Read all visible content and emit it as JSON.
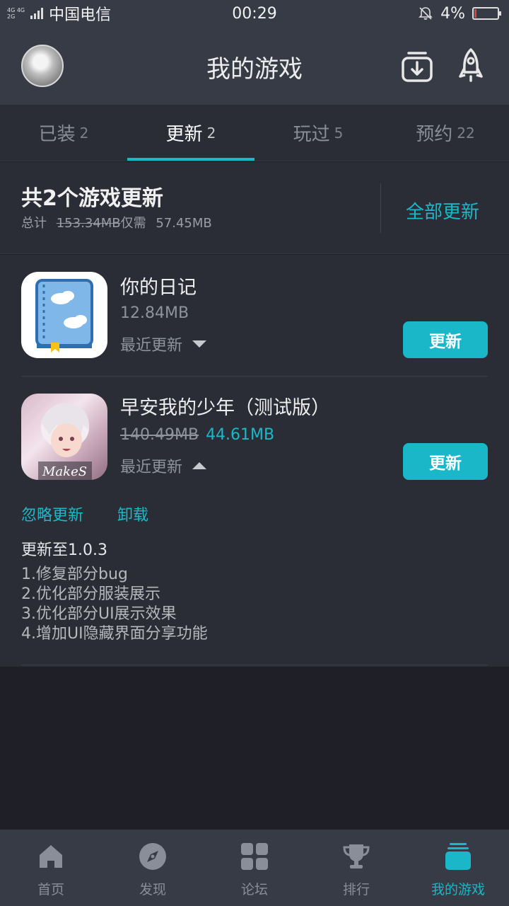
{
  "status_bar": {
    "network_top": "4G 4G",
    "network_bottom": "2G",
    "carrier": "中国电信",
    "time": "00:29",
    "battery": "4%"
  },
  "header": {
    "title": "我的游戏",
    "icons": [
      "avatar",
      "download-manager-icon",
      "rocket-icon"
    ]
  },
  "tabs": [
    {
      "label": "已装",
      "count": "2"
    },
    {
      "label": "更新",
      "count": "2",
      "active": true
    },
    {
      "label": "玩过",
      "count": "5"
    },
    {
      "label": "预约",
      "count": "22"
    }
  ],
  "summary": {
    "title": "共2个游戏更新",
    "total_label": "总计",
    "total_original": "153.34MB",
    "need_label": "仅需",
    "need_size": "57.45MB",
    "update_all": "全部更新"
  },
  "games": [
    {
      "name": "你的日记",
      "size": "12.84MB",
      "recent_label": "最近更新",
      "button": "更新",
      "expanded": false
    },
    {
      "name": "早安我的少年（测试版）",
      "old_size": "140.49MB",
      "new_size": "44.61MB",
      "recent_label": "最近更新",
      "button": "更新",
      "expanded": true,
      "icon_text": "MakeS",
      "ignore": "忽略更新",
      "uninstall": "卸载",
      "version": "更新至1.0.3",
      "notes": [
        "1.修复部分bug",
        "2.优化部分服装展示",
        "3.优化部分UI展示效果",
        "4.增加UI隐藏界面分享功能"
      ]
    }
  ],
  "bottom_nav": [
    {
      "label": "首页",
      "icon": "home-icon"
    },
    {
      "label": "发现",
      "icon": "compass-icon"
    },
    {
      "label": "论坛",
      "icon": "grid-icon"
    },
    {
      "label": "排行",
      "icon": "trophy-icon"
    },
    {
      "label": "我的游戏",
      "icon": "stack-icon",
      "active": true
    }
  ],
  "colors": {
    "accent": "#19b7c7",
    "header_bg": "#363b46",
    "panel_bg": "#2a2d36",
    "page_bg": "#1f2027"
  }
}
